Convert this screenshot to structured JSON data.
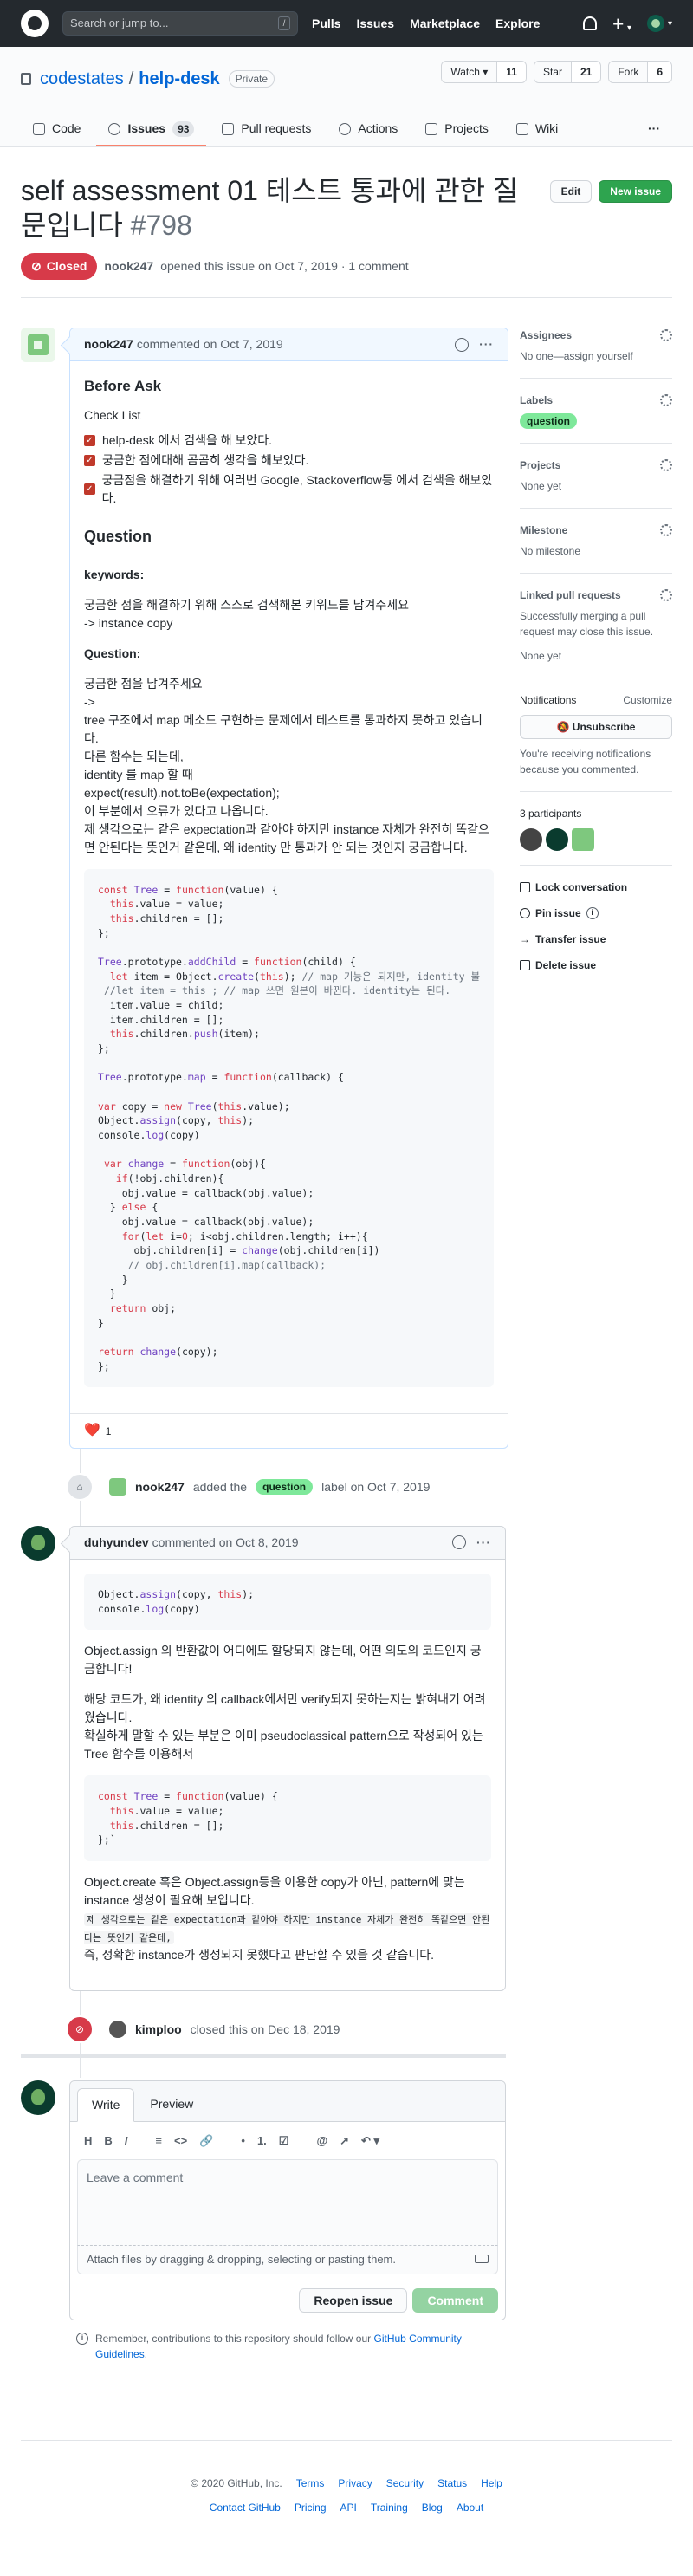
{
  "topbar": {
    "search_placeholder": "Search or jump to...",
    "slash": "/",
    "nav": [
      "Pulls",
      "Issues",
      "Marketplace",
      "Explore"
    ],
    "plus": "+",
    "caret": "▾"
  },
  "repo": {
    "owner": "codestates",
    "sep": "/",
    "name": "help-desk",
    "visibility": "Private",
    "watch_label": "Watch ▾",
    "watch_count": "11",
    "star_label": "Star",
    "star_count": "21",
    "fork_label": "Fork",
    "fork_count": "6"
  },
  "tabs": [
    {
      "label": "Code"
    },
    {
      "label": "Issues",
      "count": "93"
    },
    {
      "label": "Pull requests"
    },
    {
      "label": "Actions"
    },
    {
      "label": "Projects"
    },
    {
      "label": "Wiki"
    }
  ],
  "tabs_more": "···",
  "issue": {
    "title": "self assessment 01 테스트 통과에 관한 질문입니다",
    "number": "#798",
    "edit_label": "Edit",
    "new_issue_label": "New issue",
    "state": "Closed",
    "author": "nook247",
    "meta_text": "opened this issue on Oct 7, 2019 · 1 comment"
  },
  "comment1": {
    "author": "nook247",
    "date": "commented on Oct 7, 2019",
    "h_before": "Before Ask",
    "checklist_title": "Check List",
    "checklist": [
      "help-desk 에서 검색을 해 보았다.",
      "궁금한 점에대해 곰곰히 생각을 해보았다.",
      "궁금점을 해결하기 위해 여러번 Google, Stackoverflow등 에서 검색을 해보았다."
    ],
    "h_question": "Question",
    "keywords_label": "keywords:",
    "keywords_line1": "궁금한 점을 해결하기 위해 스스로 검색해본 키워드를 남겨주세요",
    "keywords_line2": "-> instance copy",
    "question_label": "Question:",
    "q_lines": [
      "궁금한 점을 남겨주세요",
      "->",
      "tree 구조에서 map 메소드 구현하는 문제에서 테스트를 통과하지 못하고 있습니다.",
      "다른 함수는 되는데,",
      "identity 를 map 할 때",
      "expect(result).not.toBe(expectation);",
      "이 부분에서 오류가 있다고 나옵니다.",
      "제 생각으로는 같은 expectation과 같아야 하지만 instance 자체가 완전히 똑같으면 안된다는 뜻인거 같은데, 왜 identity 만 통과가 안 되는 것인지 궁금합니다."
    ],
    "reaction_emoji": "❤️",
    "reaction_count": "1"
  },
  "event_label": {
    "actor": "nook247",
    "text1": "added the",
    "label": "question",
    "text2": "label on Oct 7, 2019"
  },
  "comment2": {
    "author": "duhyundev",
    "date": "commented on Oct 8, 2019",
    "p1": "Object.assign 의 반환값이 어디에도 할당되지 않는데, 어떤 의도의 코드인지 궁금합니다!",
    "p2": "해당 코드가, 왜 identity 의 callback에서만 verify되지 못하는지는 밝혀내기 어려웠습니다.",
    "p3": "확실하게 말할 수 있는 부분은 이미 pseudoclassical pattern으로 작성되어 있는 Tree 함수를 이용해서",
    "p4": "Object.create 혹은 Object.assign등을 이용한 copy가 아닌, pattern에 맞는 instance 생성이 필요해 보입니다.",
    "p5_code": "제 생각으로는 같은 expectation과 같아야 하지만 instance 자체가 완전히 똑같으면 안된다는 뜻인거 같은데,",
    "p6": "즉, 정확한 instance가 생성되지 못했다고 판단할 수 있을 것 같습니다."
  },
  "event_closed": {
    "actor": "kimploo",
    "text": "closed this on Dec 18, 2019"
  },
  "new_comment": {
    "tab_write": "Write",
    "tab_preview": "Preview",
    "toolbar": [
      "H",
      "B",
      "I",
      "≡",
      "<>",
      "🔗",
      "•",
      "1.",
      "☑",
      "@",
      "↗",
      "↶ ▾"
    ],
    "placeholder": "Leave a comment",
    "attach": "Attach files by dragging & dropping, selecting or pasting them.",
    "reopen_label": "Reopen issue",
    "comment_label": "Comment"
  },
  "tip": {
    "text": "Remember, contributions to this repository should follow our",
    "link": "GitHub Community Guidelines",
    "end": "."
  },
  "sidebar": {
    "assignees_title": "Assignees",
    "assignees_text": "No one—assign yourself",
    "labels_title": "Labels",
    "label": "question",
    "projects_title": "Projects",
    "projects_text": "None yet",
    "milestone_title": "Milestone",
    "milestone_text": "No milestone",
    "linked_title": "Linked pull requests",
    "linked_text": "Successfully merging a pull request may close this issue.",
    "linked_none": "None yet",
    "notifications_title": "Notifications",
    "customize": "Customize",
    "unsubscribe": "Unsubscribe",
    "notif_text": "You're receiving notifications because you commented.",
    "participants": "3 participants",
    "lock": "Lock conversation",
    "pin": "Pin issue",
    "transfer": "Transfer issue",
    "delete": "Delete issue"
  },
  "footer": {
    "copy": "© 2020 GitHub, Inc.",
    "row1": [
      "Terms",
      "Privacy",
      "Security",
      "Status",
      "Help"
    ],
    "row2": [
      "Contact GitHub",
      "Pricing",
      "API",
      "Training",
      "Blog",
      "About"
    ]
  },
  "colors": {
    "closed": "#d73a49",
    "new_issue": "#2ea44f",
    "label_question": "#7ee89a",
    "active_tab": "#f9826c"
  }
}
